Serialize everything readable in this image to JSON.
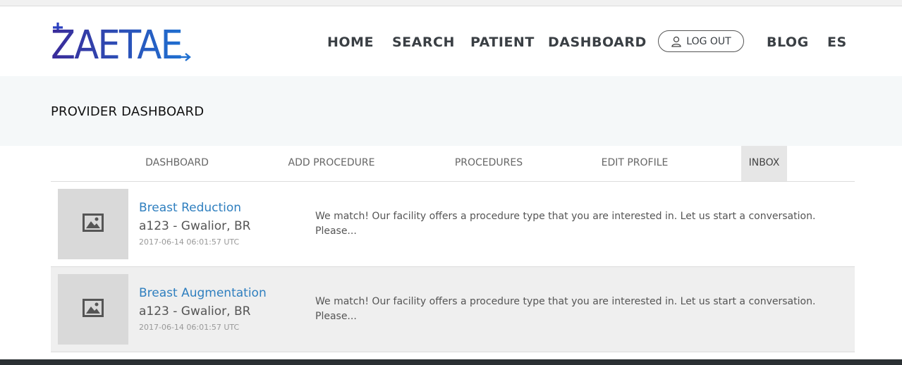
{
  "brand": {
    "logo_text": "ZAETAE",
    "logo_color_start": "#3a2a99",
    "logo_color_end": "#1f6fd0"
  },
  "nav": {
    "home": "HOME",
    "search": "SEARCH",
    "patient": "PATIENT",
    "dashboard": "DASHBOARD",
    "logout": "LOG OUT",
    "blog": "BLOG",
    "language": "ES"
  },
  "page": {
    "title": "PROVIDER DASHBOARD"
  },
  "tabs": [
    {
      "label": "DASHBOARD",
      "active": false
    },
    {
      "label": "ADD PROCEDURE",
      "active": false
    },
    {
      "label": "PROCEDURES",
      "active": false
    },
    {
      "label": "EDIT PROFILE",
      "active": false
    },
    {
      "label": "INBOX",
      "active": true
    }
  ],
  "inbox": [
    {
      "procedure": "Breast Reduction",
      "location": "a123 - Gwalior, BR",
      "timestamp": "2017-06-14 06:01:57 UTC",
      "message": "We match! Our facility offers a procedure type that you are interested in. Let us start a conversation. Please..."
    },
    {
      "procedure": "Breast Augmentation",
      "location": "a123 - Gwalior, BR",
      "timestamp": "2017-06-14 06:01:57 UTC",
      "message": "We match! Our facility offers a procedure type that you are interested in. Let us start a conversation. Please..."
    }
  ],
  "colors": {
    "link": "#2f7fbf",
    "title_band": "#f5f8f9",
    "active_tab": "#e6e6e6",
    "footer": "#2b3033"
  },
  "icons": {
    "logout": "user-icon",
    "thumbnail": "image-placeholder-icon"
  }
}
